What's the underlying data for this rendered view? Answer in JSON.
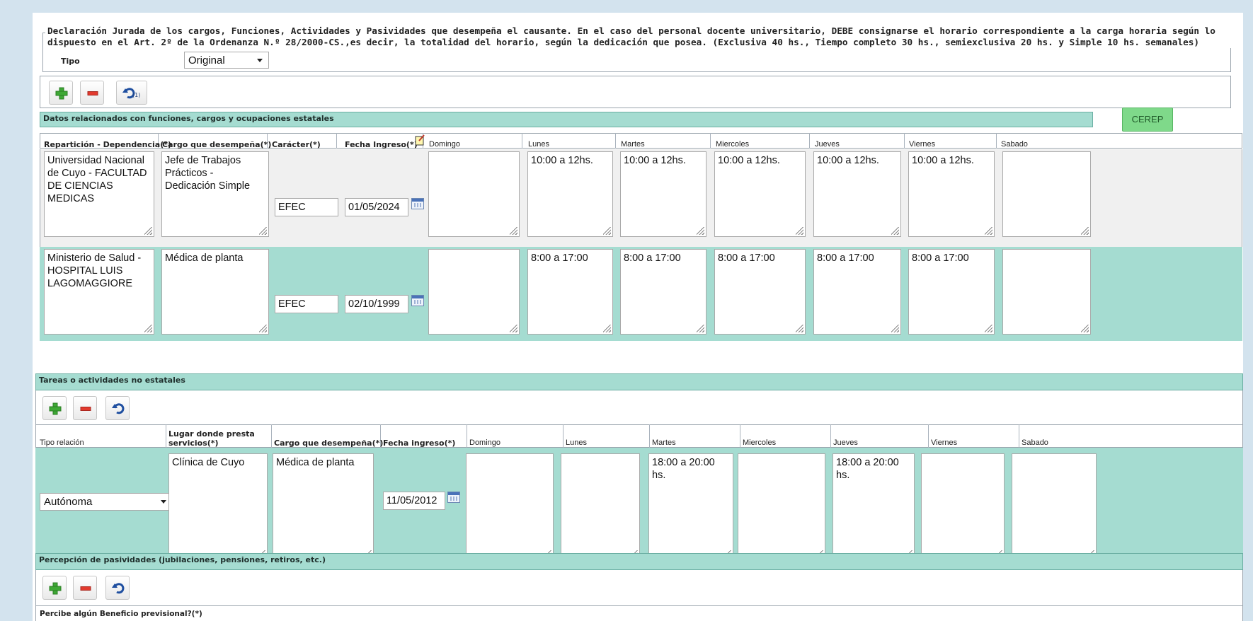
{
  "declaration": {
    "legend_line1": "Declaración Jurada de los cargos, Funciones, Actividades y Pasividades que desempeña el causante. En el caso del personal docente universitario, DEBE consignarse el horario correspondiente a la carga horaria según lo",
    "legend_line2": "dispuesto en el Art. 2º de la Ordenanza N.º 28/2000-CS.,es decir, la totalidad del horario, según la dedicación que posea. (Exclusiva 40 hs., Tiempo completo 30 hs., semiexclusiva 20 hs. y Simple 10 hs. semanales)",
    "tipo_label": "Tipo",
    "tipo_value": "Original"
  },
  "toolbar1": {
    "undo_count": "(1)"
  },
  "estatales": {
    "title": "Datos relacionados con funciones, cargos y ocupaciones estatales",
    "cerep_label": "CEREP",
    "headers": {
      "reparticion": "Repartición - Dependencia(*)",
      "cargo": "Cargo que desempeña(*)",
      "caracter": "Carácter(*)",
      "fecha": "Fecha Ingreso(*)",
      "domingo": "Domingo",
      "lunes": "Lunes",
      "martes": "Martes",
      "miercoles": "Miercoles",
      "jueves": "Jueves",
      "viernes": "Viernes",
      "sabado": "Sabado"
    },
    "rows": [
      {
        "reparticion": "Universidad Nacional de Cuyo - FACULTAD DE CIENCIAS MEDICAS",
        "cargo": "Jefe de Trabajos Prácticos - Dedicación Simple",
        "caracter": "EFEC",
        "fecha": "01/05/2024",
        "domingo": "",
        "lunes": "10:00 a 12hs.",
        "martes": "10:00 a 12hs.",
        "miercoles": "10:00 a 12hs.",
        "jueves": "10:00 a 12hs.",
        "viernes": "10:00 a 12hs.",
        "sabado": ""
      },
      {
        "reparticion": "Ministerio de Salud - HOSPITAL LUIS LAGOMAGGIORE",
        "cargo": "Médica de planta",
        "caracter": "EFEC",
        "fecha": "02/10/1999",
        "domingo": "",
        "lunes": "8:00 a 17:00",
        "martes": "8:00 a 17:00",
        "miercoles": "8:00 a 17:00",
        "jueves": "8:00 a 17:00",
        "viernes": "8:00 a 17:00",
        "sabado": ""
      }
    ]
  },
  "no_estatales": {
    "title": "Tareas o actividades no estatales",
    "headers": {
      "tipo": "Tipo relación",
      "lugar_1": "Lugar donde presta",
      "lugar_2": "servicios(*)",
      "cargo": "Cargo que desempeña(*)",
      "fecha": "Fecha ingreso(*)",
      "domingo": "Domingo",
      "lunes": "Lunes",
      "martes": "Martes",
      "miercoles": "Miercoles",
      "jueves": "Jueves",
      "viernes": "Viernes",
      "sabado": "Sabado"
    },
    "row": {
      "tipo": "Autónoma",
      "lugar": "Clínica de Cuyo",
      "cargo": "Médica de planta",
      "fecha": "11/05/2012",
      "domingo": "",
      "lunes": "",
      "martes": "18:00 a 20:00 hs.",
      "miercoles": "",
      "jueves": "18:00 a 20:00 hs.",
      "viernes": "",
      "sabado": ""
    }
  },
  "pasividades": {
    "title": "Percepción de pasividades (jubilaciones, pensiones, retiros, etc.)",
    "question": "Percibe algún Beneficio previsional?(*)"
  },
  "colors": {
    "teal": "#a5dcd1",
    "cerep_green": "#7fd98a",
    "page_bg": "#d3e3ee"
  }
}
